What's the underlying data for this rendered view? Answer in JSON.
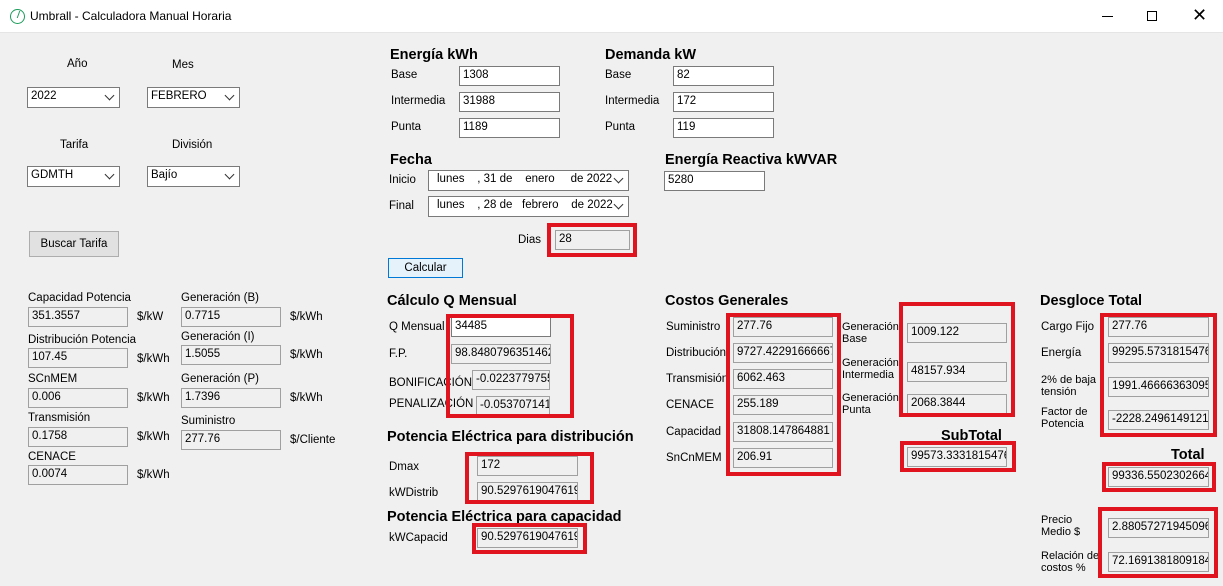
{
  "window": {
    "title": "Umbrall - Calculadora Manual Horaria",
    "min_icon": "minimize-icon",
    "max_icon": "maximize-icon",
    "close_icon": "close-icon",
    "close_glyph": "✕"
  },
  "filters": {
    "anio_label": "Año",
    "anio_value": "2022",
    "mes_label": "Mes",
    "mes_value": "FEBRERO",
    "tarifa_label": "Tarifa",
    "tarifa_value": "GDMTH",
    "division_label": "División",
    "division_value": "Bajío",
    "buscar_button": "Buscar Tarifa"
  },
  "tarifas": {
    "capacidad_potencia": {
      "label": "Capacidad Potencia",
      "value": "351.3557",
      "unit": "$/kW"
    },
    "distribucion_potencia": {
      "label": "Distribución Potencia",
      "value": "107.45",
      "unit": "$/kWh"
    },
    "scnmem": {
      "label": "SCnMEM",
      "value": "0.006",
      "unit": "$/kWh"
    },
    "transmision": {
      "label": "Transmisión",
      "value": "0.1758",
      "unit": "$/kWh"
    },
    "cenace": {
      "label": "CENACE",
      "value": "0.0074",
      "unit": "$/kWh"
    },
    "generacion_b": {
      "label": "Generación (B)",
      "value": "0.7715",
      "unit": "$/kWh"
    },
    "generacion_i": {
      "label": "Generación (I)",
      "value": "1.5055",
      "unit": "$/kWh"
    },
    "generacion_p": {
      "label": "Generación (P)",
      "value": "1.7396",
      "unit": "$/kWh"
    },
    "suministro": {
      "label": "Suministro",
      "value": "277.76",
      "unit": "$/Cliente"
    }
  },
  "energia": {
    "title": "Energía kWh",
    "base_label": "Base",
    "base_value": "1308",
    "intermedia_label": "Intermedia",
    "intermedia_value": "31988",
    "punta_label": "Punta",
    "punta_value": "1189"
  },
  "demanda": {
    "title": "Demanda kW",
    "base_label": "Base",
    "base_value": "82",
    "intermedia_label": "Intermedia",
    "intermedia_value": "172",
    "punta_label": "Punta",
    "punta_value": "119"
  },
  "fecha": {
    "title": "Fecha",
    "inicio_label": "Inicio",
    "inicio_value": "lunes    , 31 de    enero     de 2022",
    "final_label": "Final",
    "final_value": "lunes    , 28 de   febrero    de 2022",
    "dias_label": "Dias",
    "dias_value": "28"
  },
  "reactiva": {
    "title": "Energía Reactiva kWVAR",
    "value": "5280"
  },
  "calcular_button": "Calcular",
  "q_mensual": {
    "title": "Cálculo Q Mensual",
    "q_label": "Q Mensual",
    "q_value": "34485",
    "fp_label": "F.P.",
    "fp_value": "98.8480796351462",
    "bonif_label": "BONIFICACIÓN",
    "bonif_value": "-0.0223779755",
    "penal_label": "PENALIZACIÓN",
    "penal_value": "-0.053707141:"
  },
  "potencia_distribucion": {
    "title": "Potencia Eléctrica para distribución",
    "dmax_label": "Dmax",
    "dmax_value": "172",
    "kwdistrib_label": "kWDistrib",
    "kwdistrib_value": "90.5297619047619"
  },
  "potencia_capacidad": {
    "title": "Potencia Eléctrica para capacidad",
    "kwcapacid_label": "kWCapacid",
    "kwcapacid_value": "90.5297619047619"
  },
  "costos": {
    "title": "Costos Generales",
    "suministro_label": "Suministro",
    "suministro_value": "277.76",
    "distribucion_label": "Distribución",
    "distribucion_value": "9727.42291666667",
    "transmision_label": "Transmisión",
    "transmision_value": "6062.463",
    "cenace_label": "CENACE",
    "cenace_value": "255.189",
    "capacidad_label": "Capacidad",
    "capacidad_value": "31808.147864881",
    "sncnmem_label": "SnCnMEM",
    "sncnmem_value": "206.91",
    "gen_base_label_1": "Generación",
    "gen_base_label_2": "Base",
    "gen_base_value": "1009.122",
    "gen_int_label_1": "Generación",
    "gen_int_label_2": "Intermedia",
    "gen_int_value": "48157.934",
    "gen_punta_label_1": "Generación",
    "gen_punta_label_2": "Punta",
    "gen_punta_value": "2068.3844",
    "subtotal_label": "SubTotal",
    "subtotal_value": "99573.3331815476"
  },
  "desgloce": {
    "title": "Desgloce Total",
    "cargo_fijo_label": "Cargo Fijo",
    "cargo_fijo_value": "277.76",
    "energia_label": "Energía",
    "energia_value": "99295.5731815476",
    "baja_tension_label_1": "2% de baja",
    "baja_tension_label_2": "tensión",
    "baja_tension_value": "1991.46666363095",
    "factor_label_1": "Factor de",
    "factor_label_2": "Potencia",
    "factor_value": "-2228.24961491214",
    "total_label": "Total",
    "total_value": "99336.5502302664",
    "precio_label_1": "Precio",
    "precio_label_2": "Medio $",
    "precio_value": "2.88057271945096",
    "relacion_label_1": "Relación de",
    "relacion_label_2": "costos %",
    "relacion_value": "72.1691381809184"
  },
  "colors": {
    "highlight": "#e0141e",
    "window_bg": "#f0f0f0",
    "accent": "#0078d7"
  }
}
